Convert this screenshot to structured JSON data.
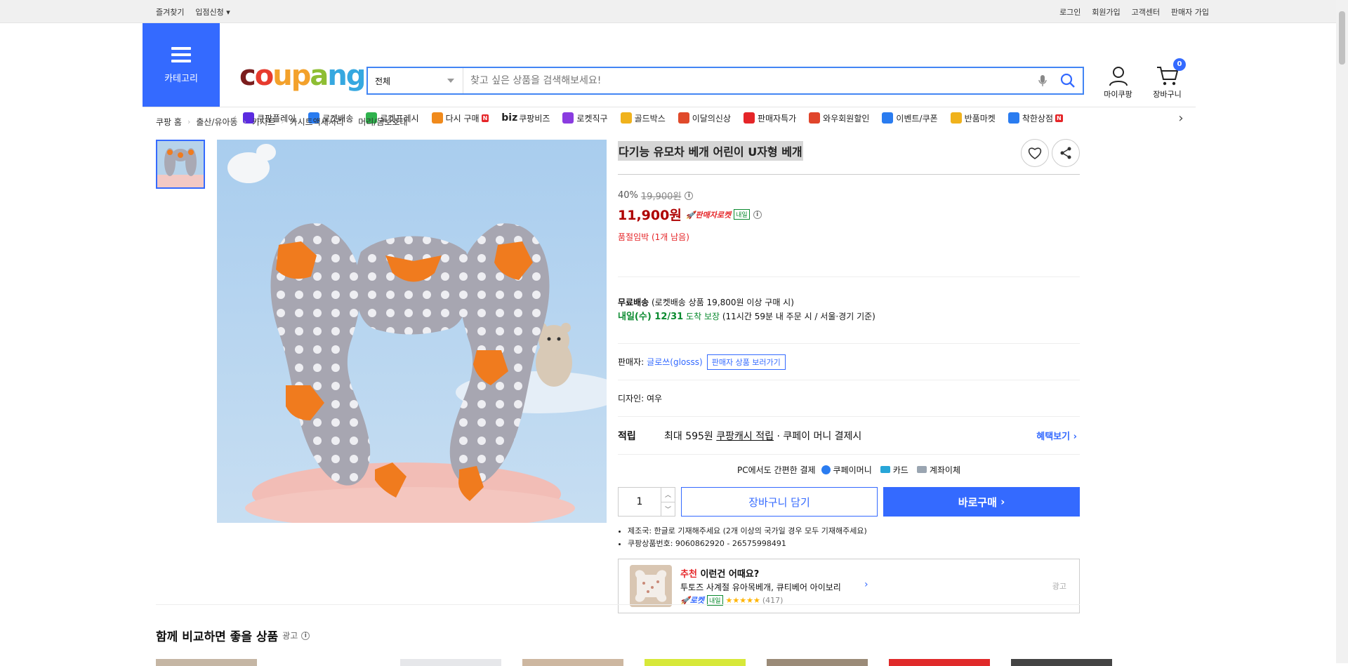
{
  "topbar": {
    "left": [
      "즐겨찾기",
      "입점신청"
    ],
    "right": [
      "로그인",
      "회원가입",
      "고객센터",
      "판매자 가입"
    ]
  },
  "header": {
    "category_label": "카테고리",
    "logo": [
      "c",
      "o",
      "u",
      "p",
      "a",
      "ng"
    ],
    "search_scope": "전체",
    "search_placeholder": "찾고 싶은 상품을 검색해보세요!",
    "my_coupang": "마이쿠팡",
    "cart": "장바구니",
    "cart_count": "0"
  },
  "catbar": [
    {
      "label": "쿠팡플레이",
      "color": "#5b2be0",
      "new": ""
    },
    {
      "label": "로켓배송",
      "color": "#2a7cf0",
      "new": ""
    },
    {
      "label": "로켓프레시",
      "color": "#2fb24d",
      "new": ""
    },
    {
      "label": "다시 구매",
      "color": "#f08a1c",
      "new": "N"
    },
    {
      "label": "쿠팡비즈",
      "color": "#ffffff",
      "new": "",
      "prefix": "biz"
    },
    {
      "label": "로켓직구",
      "color": "#8a3ce0",
      "new": ""
    },
    {
      "label": "골드박스",
      "color": "#f0b21c",
      "new": ""
    },
    {
      "label": "이달의신상",
      "color": "#e04a2b",
      "new": ""
    },
    {
      "label": "판매자특가",
      "color": "#e52528",
      "new": ""
    },
    {
      "label": "와우회원할인",
      "color": "#e0452b",
      "new": ""
    },
    {
      "label": "이벤트/쿠폰",
      "color": "#2a7cf0",
      "new": ""
    },
    {
      "label": "반품마켓",
      "color": "#f0b21c",
      "new": ""
    },
    {
      "label": "착한상점",
      "color": "#2a7cf0",
      "new": "N"
    }
  ],
  "breadcrumb": [
    "쿠팡 홈",
    "출산/유아동",
    "카시트",
    "카시트액세서리",
    "머리/몸보호대"
  ],
  "product": {
    "title": "다기능 유모차 베개 어린이 U자형 베개",
    "discount": "40%",
    "original_price": "19,900원",
    "price": "11,900원",
    "rocket_label": "판매자로켓",
    "tomorrow": "내일",
    "stock": "품절임박 (1개 남음)",
    "free_ship": "무료배송",
    "free_ship_detail": "(로켓배송 상품 19,800원 이상 구매 시)",
    "delivery_date": "내일(수) 12/31",
    "delivery_guarantee": "도착 보장",
    "delivery_detail": "(11시간 59분 내 주문 시 / 서울·경기 기준)",
    "seller_label": "판매자:",
    "seller_name": "글로쓰(glosss)",
    "seller_button": "판매자 상품 보러가기",
    "design_label": "디자인:",
    "design_value": "여우",
    "reward_label": "적립",
    "reward_text_1": "최대 595원",
    "reward_link": "쿠팡캐시 적립",
    "reward_text_2": "· 쿠페이 머니 결제시",
    "reward_more": "혜택보기",
    "pay_title": "PC에서도 간편한 결제",
    "pay_options": [
      "쿠페이머니",
      "카드",
      "계좌이체"
    ],
    "quantity": "1",
    "cart_button": "장바구니 담기",
    "buy_button": "바로구매",
    "notes": [
      "제조국: 한글로 기재해주세요 (2개 이상의 국가일 경우 모두 기재해주세요)",
      "쿠팡상품번호: 9060862920 - 26575998491"
    ],
    "reco_head_1": "추천",
    "reco_head_2": "이런건 어때요?",
    "reco_name": "투토즈 사계절 유아목베개, 큐티베어 아이보리",
    "reco_rocket": "로켓",
    "reco_tomorrow": "내일",
    "reco_stars": "★★★★★",
    "reco_reviews": "(417)",
    "reco_ad": "광고"
  },
  "compare": {
    "title": "함께 비교하면 좋을 상품",
    "ad": "광고"
  }
}
